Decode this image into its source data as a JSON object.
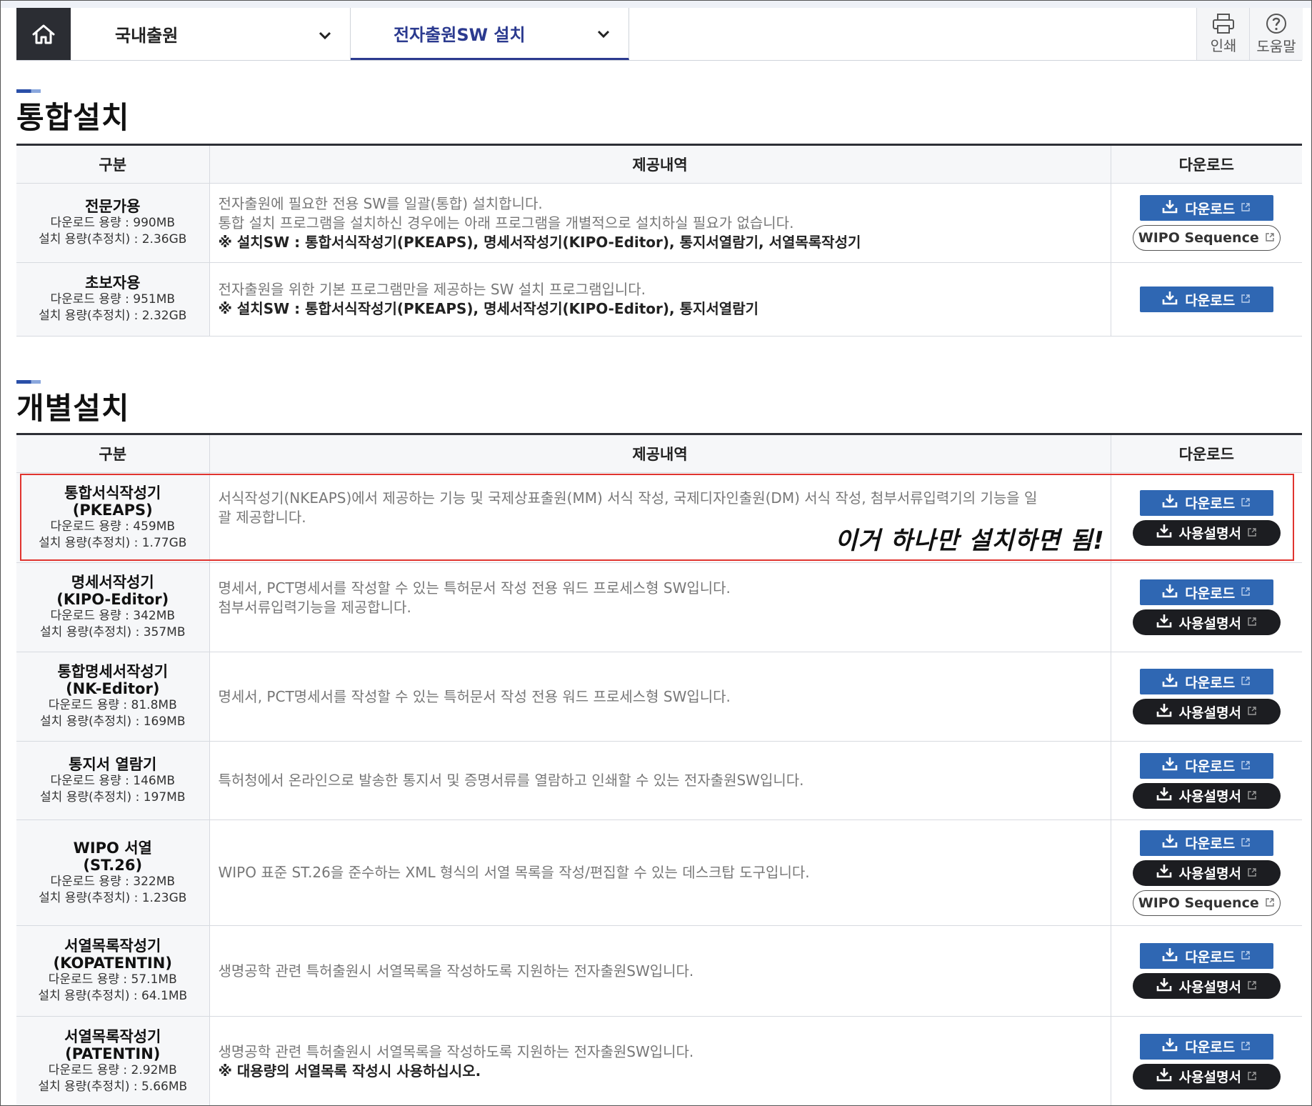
{
  "nav": {
    "menu1": "국내출원",
    "menu2": "전자출원SW 설치",
    "print_label": "인쇄",
    "help_label": "도움말"
  },
  "icons": {
    "home": "home-icon",
    "print": "printer-icon",
    "help": "question-circle-icon",
    "chevron": "chevron-down-icon",
    "download": "download-icon",
    "external": "external-link-icon"
  },
  "colors": {
    "accent": "#2b3a8f",
    "download_button": "#2f67b3",
    "manual_button": "#1c1d21",
    "highlight_border": "#e0342f"
  },
  "labels": {
    "download": "다운로드",
    "manual": "사용설명서",
    "wipo_sequence": "WIPO Sequence"
  },
  "integrated": {
    "title": "통합설치",
    "headers": [
      "구분",
      "제공내역",
      "다운로드"
    ],
    "rows": [
      {
        "name": "전문가용",
        "download_size": "다운로드 용량 : 990MB",
        "install_size": "설치 용량(추정치) : 2.36GB",
        "desc1": "전자출원에 필요한 전용 SW를 일괄(통합) 설치합니다.",
        "desc2": "통합 설치 프로그램을 설치하신 경우에는 아래 프로그램을 개별적으로 설치하실 필요가 없습니다.",
        "note": "※ 설치SW : 통합서식작성기(PKEAPS), 명세서작성기(KIPO-Editor), 통지서열람기, 서열목록작성기"
      },
      {
        "name": "초보자용",
        "download_size": "다운로드 용량 : 951MB",
        "install_size": "설치 용량(추정치) : 2.32GB",
        "desc1": "전자출원을 위한 기본 프로그램만을 제공하는 SW 설치 프로그램입니다.",
        "note": "※ 설치SW : 통합서식작성기(PKEAPS), 명세서작성기(KIPO-Editor), 통지서열람기"
      }
    ]
  },
  "individual": {
    "title": "개별설치",
    "headers": [
      "구분",
      "제공내역",
      "다운로드"
    ],
    "rows": [
      {
        "name": "통합서식작성기",
        "sub": "(PKEAPS)",
        "download_size": "다운로드 용량 : 459MB",
        "install_size": "설치 용량(추정치) : 1.77GB",
        "desc1": "서식작성기(NKEAPS)에서 제공하는 기능 및 국제상표출원(MM) 서식 작성, 국제디자인출원(DM) 서식 작성, 첨부서류입력기의 기능을 일",
        "desc2": "괄 제공합니다."
      },
      {
        "name": "명세서작성기",
        "sub": "(KIPO-Editor)",
        "download_size": "다운로드 용량 : 342MB",
        "install_size": "설치 용량(추정치) : 357MB",
        "desc1": "명세서, PCT명세서를 작성할 수 있는 특허문서 작성 전용 워드 프로세스형 SW입니다.",
        "desc2": "첨부서류입력기능을 제공합니다."
      },
      {
        "name": "통합명세서작성기",
        "sub": "(NK-Editor)",
        "download_size": "다운로드 용량 : 81.8MB",
        "install_size": "설치 용량(추정치) : 169MB",
        "desc1": "명세서, PCT명세서를 작성할 수 있는 특허문서 작성 전용 워드 프로세스형 SW입니다."
      },
      {
        "name": "통지서 열람기",
        "download_size": "다운로드 용량 : 146MB",
        "install_size": "설치 용량(추정치) : 197MB",
        "desc1": "특허청에서 온라인으로 발송한 통지서 및 증명서류를 열람하고 인쇄할 수 있는 전자출원SW입니다."
      },
      {
        "name": "WIPO 서열",
        "sub": "(ST.26)",
        "download_size": "다운로드 용량 : 322MB",
        "install_size": "설치 용량(추정치) : 1.23GB",
        "desc1": "WIPO 표준 ST.26을 준수하는 XML 형식의 서열 목록을 작성/편집할 수 있는 데스크탑 도구입니다."
      },
      {
        "name": "서열목록작성기",
        "sub": "(KOPATENTIN)",
        "download_size": "다운로드 용량 : 57.1MB",
        "install_size": "설치 용량(추정치) : 64.1MB",
        "desc1": "생명공학 관련 특허출원시 서열목록을 작성하도록 지원하는 전자출원SW입니다."
      },
      {
        "name": "서열목록작성기",
        "sub": "(PATENTIN)",
        "download_size": "다운로드 용량 : 2.92MB",
        "install_size": "설치 용량(추정치) : 5.66MB",
        "desc1": "생명공학 관련 특허출원시 서열목록을 작성하도록 지원하는 전자출원SW입니다.",
        "note": "※ 대용량의 서열목록 작성시 사용하십시오."
      }
    ]
  },
  "annotation": "이거 하나만 설치하면 됨!"
}
